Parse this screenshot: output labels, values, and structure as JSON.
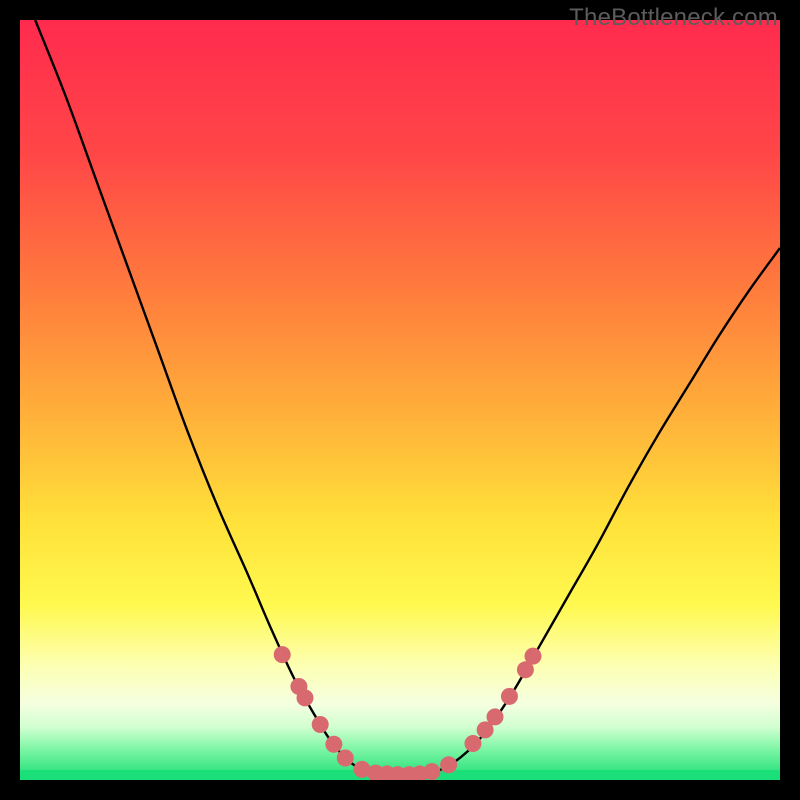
{
  "watermark": "TheBottleneck.com",
  "colors": {
    "frame": "#000000",
    "curve": "#000000",
    "marker_fill": "#d86a6f",
    "green_band": "#1be07a",
    "gradient_stops": [
      {
        "offset": 0,
        "color": "#ff2b4e"
      },
      {
        "offset": 18,
        "color": "#ff4747"
      },
      {
        "offset": 35,
        "color": "#ff7a3d"
      },
      {
        "offset": 52,
        "color": "#ffb03a"
      },
      {
        "offset": 66,
        "color": "#ffe13a"
      },
      {
        "offset": 77,
        "color": "#fff94f"
      },
      {
        "offset": 85,
        "color": "#fdffb3"
      },
      {
        "offset": 90,
        "color": "#f5ffe0"
      },
      {
        "offset": 93,
        "color": "#d2ffd2"
      },
      {
        "offset": 96,
        "color": "#7cf5a4"
      },
      {
        "offset": 100,
        "color": "#18dd74"
      }
    ]
  },
  "chart_data": {
    "type": "line",
    "title": "",
    "xlabel": "",
    "ylabel": "",
    "xlim": [
      0,
      100
    ],
    "ylim": [
      0,
      100
    ],
    "grid": false,
    "curve": [
      {
        "x": 2.0,
        "y": 100.0
      },
      {
        "x": 6.0,
        "y": 90.0
      },
      {
        "x": 10.0,
        "y": 79.0
      },
      {
        "x": 14.0,
        "y": 68.0
      },
      {
        "x": 18.0,
        "y": 57.0
      },
      {
        "x": 22.0,
        "y": 46.0
      },
      {
        "x": 26.0,
        "y": 36.0
      },
      {
        "x": 30.0,
        "y": 27.0
      },
      {
        "x": 33.0,
        "y": 20.0
      },
      {
        "x": 36.0,
        "y": 13.5
      },
      {
        "x": 38.5,
        "y": 9.0
      },
      {
        "x": 41.0,
        "y": 5.0
      },
      {
        "x": 43.5,
        "y": 2.3
      },
      {
        "x": 46.0,
        "y": 1.0
      },
      {
        "x": 49.0,
        "y": 0.7
      },
      {
        "x": 52.0,
        "y": 0.7
      },
      {
        "x": 55.0,
        "y": 1.2
      },
      {
        "x": 58.0,
        "y": 3.0
      },
      {
        "x": 61.0,
        "y": 6.0
      },
      {
        "x": 64.5,
        "y": 11.0
      },
      {
        "x": 68.0,
        "y": 17.0
      },
      {
        "x": 72.0,
        "y": 24.0
      },
      {
        "x": 76.0,
        "y": 31.0
      },
      {
        "x": 80.0,
        "y": 38.5
      },
      {
        "x": 84.0,
        "y": 45.5
      },
      {
        "x": 88.0,
        "y": 52.0
      },
      {
        "x": 92.0,
        "y": 58.5
      },
      {
        "x": 96.0,
        "y": 64.5
      },
      {
        "x": 100.0,
        "y": 70.0
      }
    ],
    "markers": [
      {
        "x": 34.5,
        "y": 16.5
      },
      {
        "x": 36.7,
        "y": 12.3
      },
      {
        "x": 37.5,
        "y": 10.8
      },
      {
        "x": 39.5,
        "y": 7.3
      },
      {
        "x": 41.3,
        "y": 4.7
      },
      {
        "x": 42.8,
        "y": 2.9
      },
      {
        "x": 45.0,
        "y": 1.4
      },
      {
        "x": 46.8,
        "y": 0.9
      },
      {
        "x": 48.3,
        "y": 0.8
      },
      {
        "x": 49.7,
        "y": 0.7
      },
      {
        "x": 51.2,
        "y": 0.7
      },
      {
        "x": 52.6,
        "y": 0.8
      },
      {
        "x": 54.2,
        "y": 1.1
      },
      {
        "x": 56.4,
        "y": 2.0
      },
      {
        "x": 59.6,
        "y": 4.8
      },
      {
        "x": 61.2,
        "y": 6.6
      },
      {
        "x": 62.5,
        "y": 8.3
      },
      {
        "x": 64.4,
        "y": 11.0
      },
      {
        "x": 66.5,
        "y": 14.5
      },
      {
        "x": 67.5,
        "y": 16.3
      }
    ]
  }
}
